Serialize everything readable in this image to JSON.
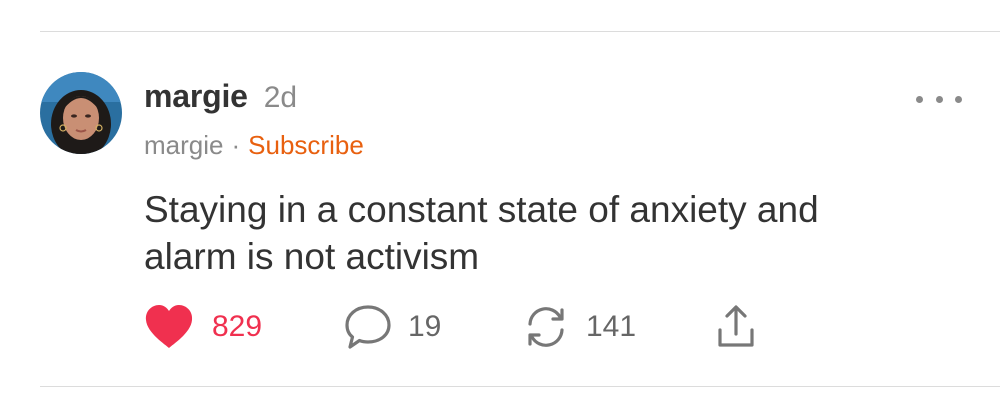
{
  "post": {
    "author": "margie",
    "time_ago": "2d",
    "handle": "margie",
    "separator": "·",
    "subscribe_label": "Subscribe",
    "body_line_1": "Staying in a constant state of anxiety and",
    "body_line_2": "alarm is not activism"
  },
  "actions": {
    "likes": "829",
    "comments": "19",
    "restacks": "141"
  },
  "colors": {
    "like": "#f0304f",
    "subscribe": "#e8600f",
    "muted": "#8a8a8a",
    "text": "#333333"
  },
  "icons": {
    "like": "heart-icon",
    "comment": "comment-bubble-icon",
    "restack": "restack-arrows-icon",
    "share": "share-upload-icon",
    "more": "more-dots-icon"
  }
}
